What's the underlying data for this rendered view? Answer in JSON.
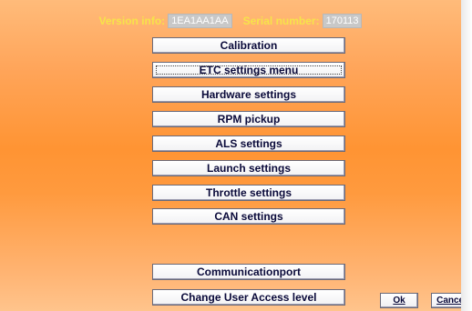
{
  "info": {
    "version_label": "Version info:",
    "version_value": "1EA1AA1AA",
    "serial_label": "Serial number:",
    "serial_value": "170113"
  },
  "menu": {
    "calibration": "Calibration",
    "etc_settings": "ETC settings menu",
    "hardware_settings": "Hardware settings",
    "rpm_pickup": "RPM pickup",
    "als_settings": "ALS settings",
    "launch_settings": "Launch settings",
    "throttle_settings": "Throttle settings",
    "can_settings": "CAN settings",
    "communication_port": "Communicationport",
    "change_user_access": "Change User Access level"
  },
  "dialog": {
    "ok": "Ok",
    "cancel": "Cancel"
  },
  "colors": {
    "accent_text": "#f7e34a",
    "panel_orange": "#ff9433"
  }
}
